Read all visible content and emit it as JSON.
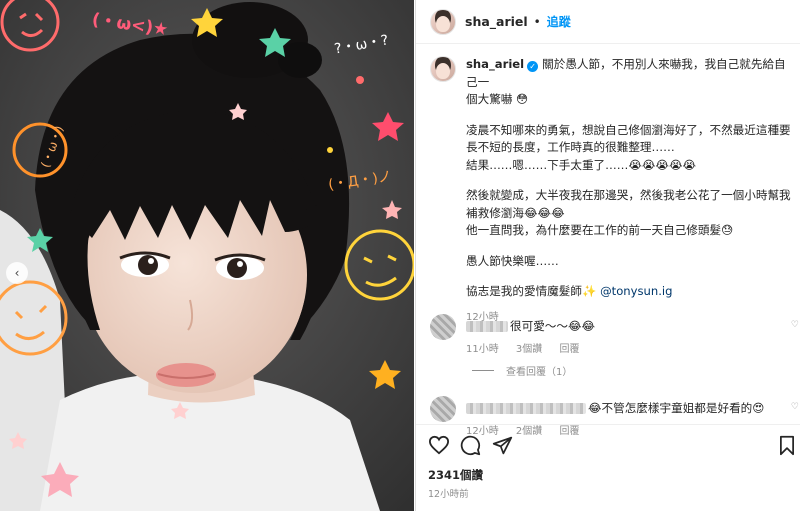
{
  "post": {
    "username": "sha_ariel",
    "dot": "•",
    "follow_label": "追蹤",
    "caption": {
      "p1": [
        "關於愚人節，不用別人來嚇我，我自己就先給自己一",
        "個大驚嚇 😳"
      ],
      "p2": [
        "凌晨不知哪來的勇氣，想說自己修個瀏海好了，不然最近這種要",
        "長不短的長度，工作時真的很難整理……",
        "結果……嗯……下手太重了……😭😭😭😭😭"
      ],
      "p3": [
        "然後就變成，大半夜我在那邊哭，然後我老公花了一個小時幫我",
        "補救修瀏海😂😂😂",
        "他一直問我，為什麼要在工作的前一天自己修頭髮😓"
      ],
      "p4": [
        "愚人節快樂喔……"
      ],
      "p5_text": "協志是我的愛情魔髮師✨",
      "p5_mention": "@tonysun.ig",
      "time": "12小時"
    },
    "comments": [
      {
        "text": "很可愛～～😂😂",
        "time": "11小時",
        "likes": "3個讚",
        "reply": "回覆"
      },
      {
        "text": "😂不管怎麼樣宇童姐都是好看的😍",
        "time": "12小時",
        "likes": "2個讚",
        "reply": "回覆"
      }
    ],
    "view_replies": "查看回覆（1）",
    "likes": "2341個讚",
    "ago": "12小時前"
  },
  "photo": {
    "emoticons": [
      "(・ω<)★",
      "?・ω・?",
      "(・Д・)ノ",
      "(・ω・)"
    ]
  },
  "icons": [
    "heart-icon",
    "comment-icon",
    "share-icon",
    "bookmark-icon",
    "verified-icon",
    "chevron-left-icon",
    "small-heart-icon"
  ],
  "colors": {
    "accent": "#0095f6",
    "mention": "#00376b",
    "muted": "#8e8e8e",
    "text": "#262626"
  }
}
